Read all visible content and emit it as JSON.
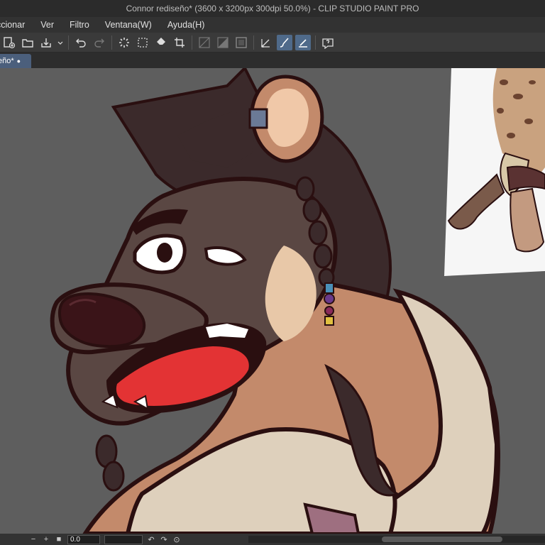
{
  "window": {
    "title": "Connor rediseño* (3600 x 3200px 300dpi 50.0%)  - CLIP STUDIO PAINT PRO"
  },
  "menu": {
    "items": [
      "eccionar",
      "Ver",
      "Filtro",
      "Ventana(W)",
      "Ayuda(H)"
    ]
  },
  "toolbar": {
    "icons": [
      "new-file-icon",
      "open-folder-icon",
      "save-icon",
      "dropdown-icon",
      "undo-icon",
      "redo-icon",
      "loading-icon",
      "select-all-icon",
      "fill-icon",
      "crop-icon",
      "grid-icon",
      "ruler-icon",
      "frame-icon",
      "pen-icon",
      "brush-icon",
      "eraser-icon",
      "help-icon"
    ]
  },
  "tab": {
    "label": "eño*",
    "modified_dot": "●"
  },
  "status": {
    "minus": "−",
    "plus": "+",
    "square": "■",
    "rotation_value": "0.0",
    "rotate_left": "↶",
    "rotate_right": "↷",
    "reset": "⊙"
  },
  "colors": {
    "canvas_bg": "#5e5e5e",
    "fur_brown": "#5a4743",
    "tan": "#c38a6b",
    "outline": "#2a0f10",
    "mouth_red": "#e33334",
    "shirt": "#ded0bc",
    "active_tool": "#4f6a8a"
  }
}
